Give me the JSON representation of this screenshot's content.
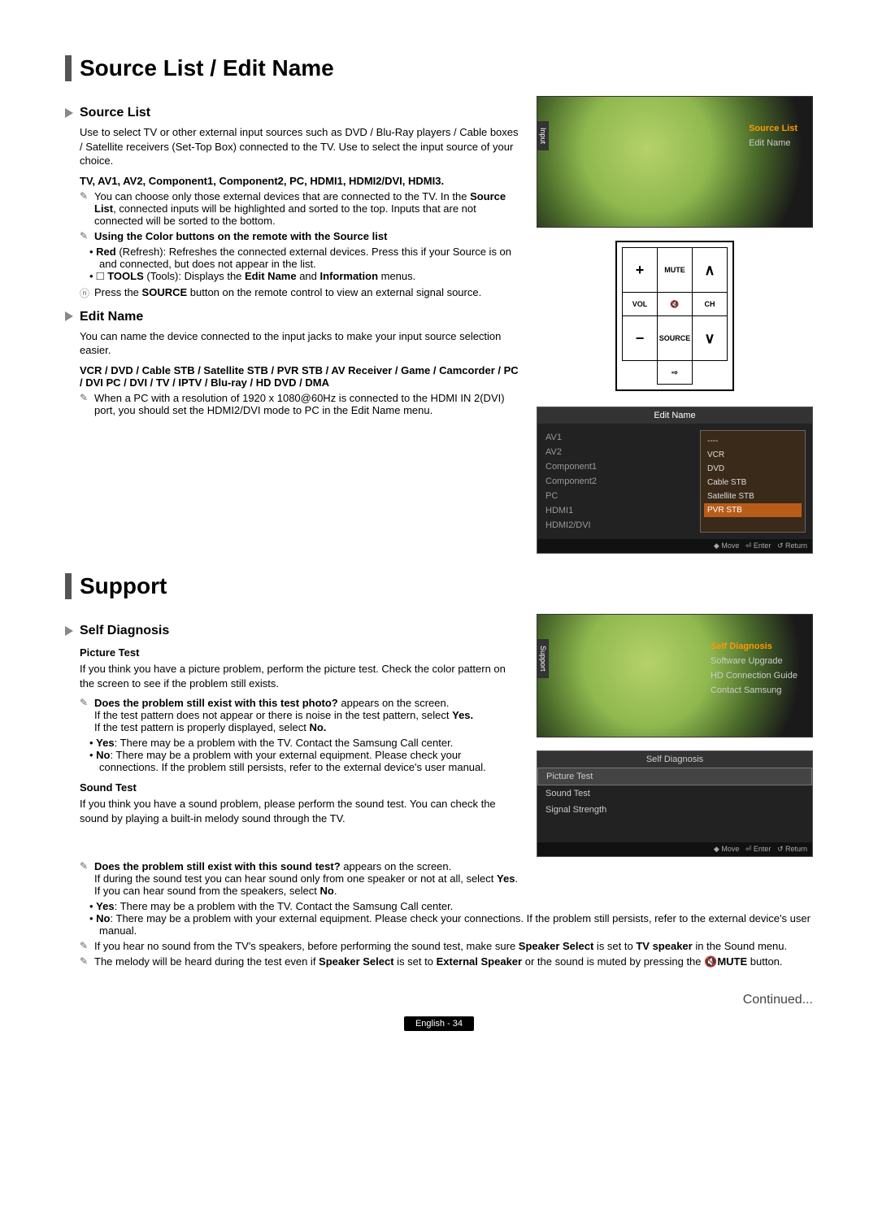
{
  "titles": {
    "h1a": "Source List / Edit Name",
    "h1b": "Support",
    "source_list": "Source List",
    "edit_name": "Edit Name",
    "self_diag": "Self Diagnosis",
    "picture_test": "Picture Test",
    "sound_test": "Sound Test",
    "continued": "Continued...",
    "page": "English - 34"
  },
  "source_list": {
    "intro": "Use to select TV or other external input sources such as DVD / Blu-Ray players / Cable boxes / Satellite receivers (Set-Top Box) connected to the TV. Use to select the input source of your choice.",
    "sources": "TV, AV1, AV2, Component1, Component2, PC, HDMI1, HDMI2/DVI, HDMI3.",
    "note1_pre": "You can choose only those external devices that are connected to the TV. In the ",
    "note1_bold": "Source List",
    "note1_post": ", connected inputs will be highlighted and sorted to the top. Inputs that are not connected will be sorted to the bottom.",
    "color_bold": "Using the Color buttons on the remote with the Source list",
    "red_bold": "Red",
    "red_txt": " (Refresh): Refreshes the connected external devices. Press this if your Source is on and connected, but does not appear in the list.",
    "tools_bold": "TOOLS",
    "tools_txt": " (Tools): Displays the ",
    "tools_b2": "Edit Name",
    "tools_mid": " and ",
    "tools_b3": "Information",
    "tools_end": " menus.",
    "press_pre": "Press the ",
    "press_bold": "SOURCE",
    "press_post": " button on the remote control to view an external signal source."
  },
  "edit_name": {
    "intro": "You can name the device connected to the input jacks to make your input source selection easier.",
    "devices": "VCR / DVD / Cable STB / Satellite STB / PVR STB / AV Receiver / Game / Camcorder / PC / DVI PC / DVI / TV / IPTV / Blu-ray / HD DVD / DMA",
    "pc_note": "When a PC with a resolution of 1920 x 1080@60Hz is connected to the HDMI IN 2(DVI) port, you should set the HDMI2/DVI mode to PC in the Edit Name menu."
  },
  "self_diag": {
    "pic_intro": "If you think you have a picture problem, perform the picture test. Check the color pattern on the screen to see if the problem still exists.",
    "pic_q_bold": "Does the problem still exist with this test photo?",
    "pic_q_post": " appears on the screen.",
    "pic_l1_pre": "If the test pattern does not appear or there is noise in the test pattern, select ",
    "pic_l1_bold": "Yes.",
    "pic_l2_pre": "If the test pattern is properly displayed, select ",
    "pic_l2_bold": "No.",
    "pic_yes_b": "Yes",
    "pic_yes_t": ": There may be a problem with the TV. Contact the Samsung Call center.",
    "pic_no_b": "No",
    "pic_no_t": ": There may be a problem with your external equipment. Please check your connections. If the problem still persists, refer to the external device's user manual.",
    "snd_intro": "If you think you have a sound problem, please perform the sound test. You can check the sound by playing a built-in melody sound through the TV.",
    "snd_q_bold": "Does the problem still exist with this sound test?",
    "snd_q_post": " appears on the screen.",
    "snd_l1_pre": "If during the sound test you can hear sound only from one speaker or not at all, select ",
    "snd_l1_bold": "Yes",
    "snd_l1_post": ".",
    "snd_l2_pre": "If you can hear sound from the speakers, select ",
    "snd_l2_bold": "No",
    "snd_l2_post": ".",
    "snd_yes_b": "Yes",
    "snd_yes_t": ": There may be a problem with the TV. Contact the Samsung Call center.",
    "snd_no_b": "No",
    "snd_no_t": ": There may be a problem with your external equipment. Please check your connections. If the problem still persists, refer to the external device's user manual.",
    "snd_n3_pre": "If you hear no sound from the TV's speakers, before performing the sound test, make sure ",
    "snd_n3_b1": "Speaker Select",
    "snd_n3_mid": " is set to ",
    "snd_n3_b2": "TV speaker",
    "snd_n3_post": " in the Sound menu.",
    "snd_n4_pre": "The melody will be heard during the test even if ",
    "snd_n4_b1": "Speaker Select",
    "snd_n4_mid": " is set to ",
    "snd_n4_b2": "External Speaker",
    "snd_n4_mid2": " or the sound is muted by pressing the ",
    "snd_n4_b3": "MUTE",
    "snd_n4_post": " button."
  },
  "osd1": {
    "tab": "Input",
    "i1": "Source List",
    "i2": "Edit Name"
  },
  "remote": {
    "mute": "MUTE",
    "vol": "VOL",
    "source": "SOURCE",
    "ch": "CH",
    "plus": "+",
    "minus": "−",
    "up": "∧",
    "down": "∨",
    "mute_icon": "🔇",
    "src_icon": "⇨"
  },
  "osd2": {
    "hdr": "Edit Name",
    "l": [
      "AV1",
      "AV2",
      "Component1",
      "Component2",
      "PC",
      "HDMI1",
      "HDMI2/DVI"
    ],
    "sep": "----",
    "r": [
      "VCR",
      "DVD",
      "Cable STB",
      "Satellite STB",
      "PVR STB"
    ],
    "ftr_move": "◆ Move",
    "ftr_enter": "⏎ Enter",
    "ftr_return": "↺ Return"
  },
  "osd3": {
    "tab": "Support",
    "i1": "Self Diagnosis",
    "i2": "Software Upgrade",
    "i3": "HD Connection Guide",
    "i4": "Contact Samsung"
  },
  "osd4": {
    "hdr": "Self Diagnosis",
    "r1": "Picture Test",
    "r2": "Sound Test",
    "r3": "Signal Strength",
    "ftr_move": "◆ Move",
    "ftr_enter": "⏎ Enter",
    "ftr_return": "↺ Return"
  },
  "icons": {
    "note": "✎",
    "tools": "🞎",
    "btn": "ⓝ",
    "mute": "🔇"
  }
}
